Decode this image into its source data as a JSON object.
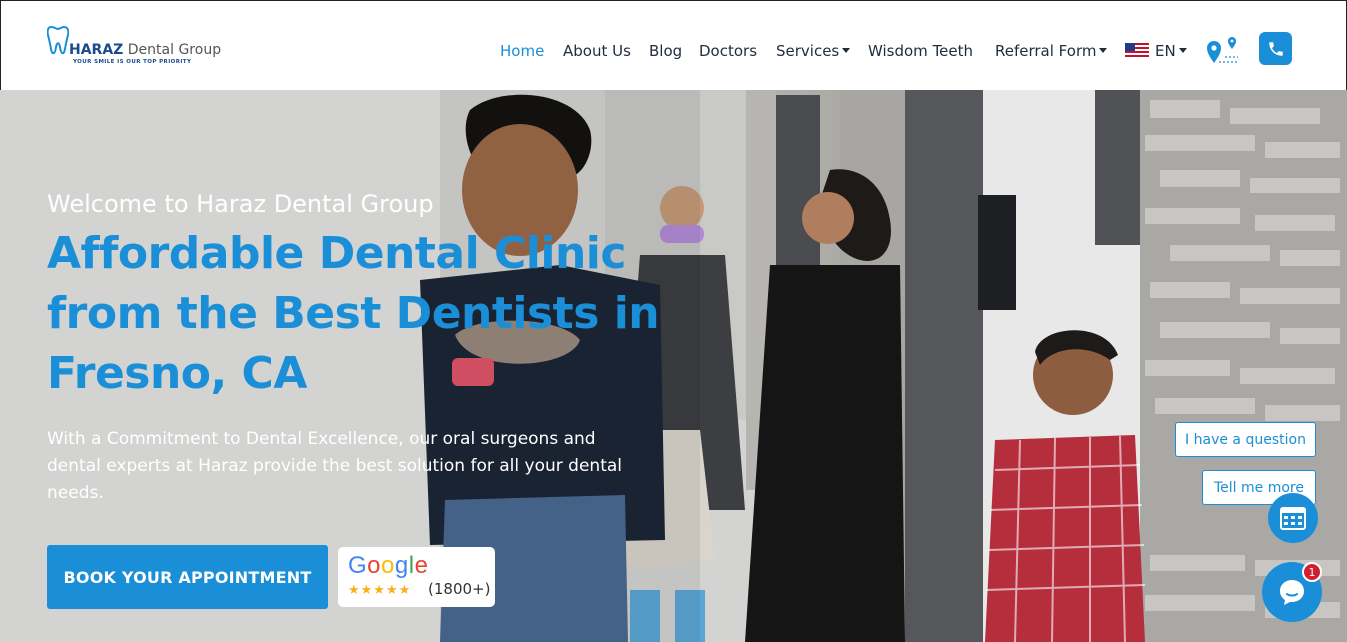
{
  "brand": {
    "name_bold": "HARAZ",
    "name_rest": " Dental Group",
    "tagline": "YOUR SMILE IS OUR TOP PRIORITY"
  },
  "nav": {
    "items": [
      {
        "label": "Home",
        "active": true
      },
      {
        "label": "About Us"
      },
      {
        "label": "Blog"
      },
      {
        "label": "Doctors"
      },
      {
        "label": "Services",
        "dropdown": true
      },
      {
        "label": "Wisdom Teeth"
      },
      {
        "label": "Referral Form",
        "dropdown": true
      }
    ],
    "language": "EN"
  },
  "hero": {
    "eyebrow": "Welcome to Haraz Dental Group",
    "title": "Affordable Dental Clinic from the Best Dentists in Fresno, CA",
    "description": "With a Commitment to Dental Excellence, our oral surgeons and dental experts at Haraz provide the best solution for all your dental needs.",
    "cta": "BOOK YOUR APPOINTMENT",
    "google": {
      "word": [
        "G",
        "o",
        "o",
        "g",
        "l",
        "e"
      ],
      "stars": "★★★★★",
      "reviews": "(1800+)"
    }
  },
  "chat": {
    "prompt_1": "I have a question",
    "prompt_2": "Tell me more",
    "unread": "1"
  },
  "colors": {
    "accent": "#1a8fd8",
    "nav_text": "#1f2d3d",
    "badge_red": "#d21f2e"
  },
  "icons": [
    "tooth-logo-icon",
    "caret-down-icon",
    "us-flag-icon",
    "location-pin-icon",
    "phone-icon",
    "calendar-icon",
    "chat-bubble-icon",
    "star-icon"
  ]
}
